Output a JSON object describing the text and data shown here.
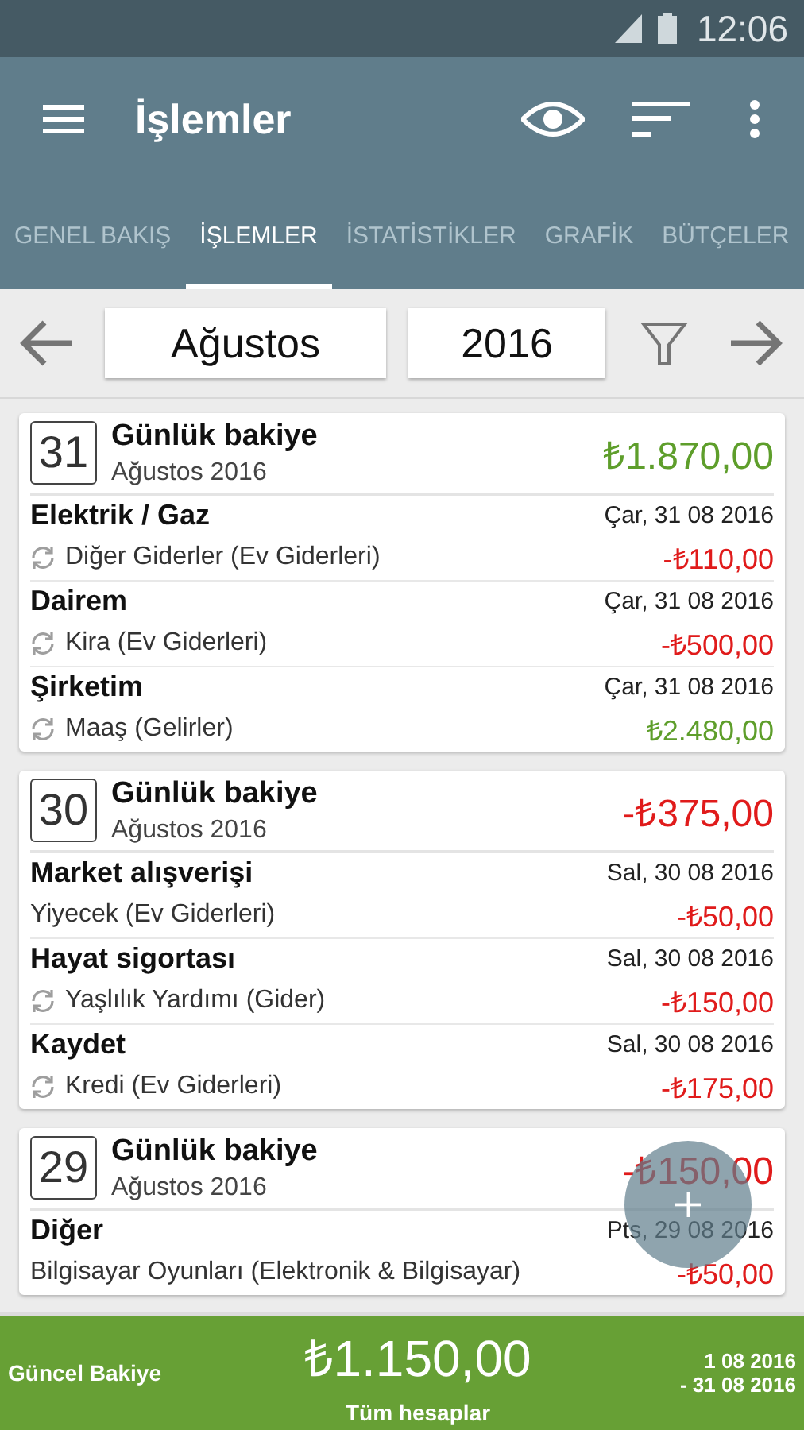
{
  "status_bar": {
    "time": "12:06"
  },
  "toolbar": {
    "title": "İşlemler"
  },
  "tabs": [
    {
      "label": "GENEL BAKIŞ",
      "selected": false
    },
    {
      "label": "İŞLEMLER",
      "selected": true
    },
    {
      "label": "İSTATİSTİKLER",
      "selected": false
    },
    {
      "label": "GRAFİK",
      "selected": false
    },
    {
      "label": "BÜTÇELER",
      "selected": false
    }
  ],
  "period": {
    "month": "Ağustos",
    "year": "2016"
  },
  "days": [
    {
      "day": "31",
      "title": "Günlük bakiye",
      "subtitle": "Ağustos 2016",
      "balance": "₺1.870,00",
      "negative": false,
      "transactions": [
        {
          "name": "Elektrik / Gaz",
          "date": "Çar, 31 08 2016",
          "category": "Diğer Giderler (Ev Giderleri)",
          "amount": "-₺110,00",
          "negative": true,
          "recurring": true
        },
        {
          "name": "Dairem",
          "date": "Çar, 31 08 2016",
          "category": "Kira (Ev Giderleri)",
          "amount": "-₺500,00",
          "negative": true,
          "recurring": true
        },
        {
          "name": "Şirketim",
          "date": "Çar, 31 08 2016",
          "category": "Maaş (Gelirler)",
          "amount": "₺2.480,00",
          "negative": false,
          "recurring": true
        }
      ]
    },
    {
      "day": "30",
      "title": "Günlük bakiye",
      "subtitle": "Ağustos 2016",
      "balance": "-₺375,00",
      "negative": true,
      "transactions": [
        {
          "name": "Market alışverişi",
          "date": "Sal, 30 08 2016",
          "category": "Yiyecek (Ev Giderleri)",
          "amount": "-₺50,00",
          "negative": true,
          "recurring": false
        },
        {
          "name": "Hayat sigortası",
          "date": "Sal, 30 08 2016",
          "category": "Yaşlılık Yardımı (Gider)",
          "amount": "-₺150,00",
          "negative": true,
          "recurring": true
        },
        {
          "name": "Kaydet",
          "date": "Sal, 30 08 2016",
          "category": "Kredi (Ev Giderleri)",
          "amount": "-₺175,00",
          "negative": true,
          "recurring": true
        }
      ]
    },
    {
      "day": "29",
      "title": "Günlük bakiye",
      "subtitle": "Ağustos 2016",
      "balance": "-₺150,00",
      "negative": true,
      "transactions": [
        {
          "name": "Diğer",
          "date": "Pts, 29 08 2016",
          "category": "Bilgisayar Oyunları (Elektronik & Bilgisayar)",
          "amount": "-₺50,00",
          "negative": true,
          "recurring": false
        }
      ]
    }
  ],
  "footer": {
    "label": "Güncel Bakiye",
    "balance": "₺1.150,00",
    "accounts": "Tüm hesaplar",
    "range_start": "1 08 2016",
    "range_end": "- 31 08 2016"
  }
}
